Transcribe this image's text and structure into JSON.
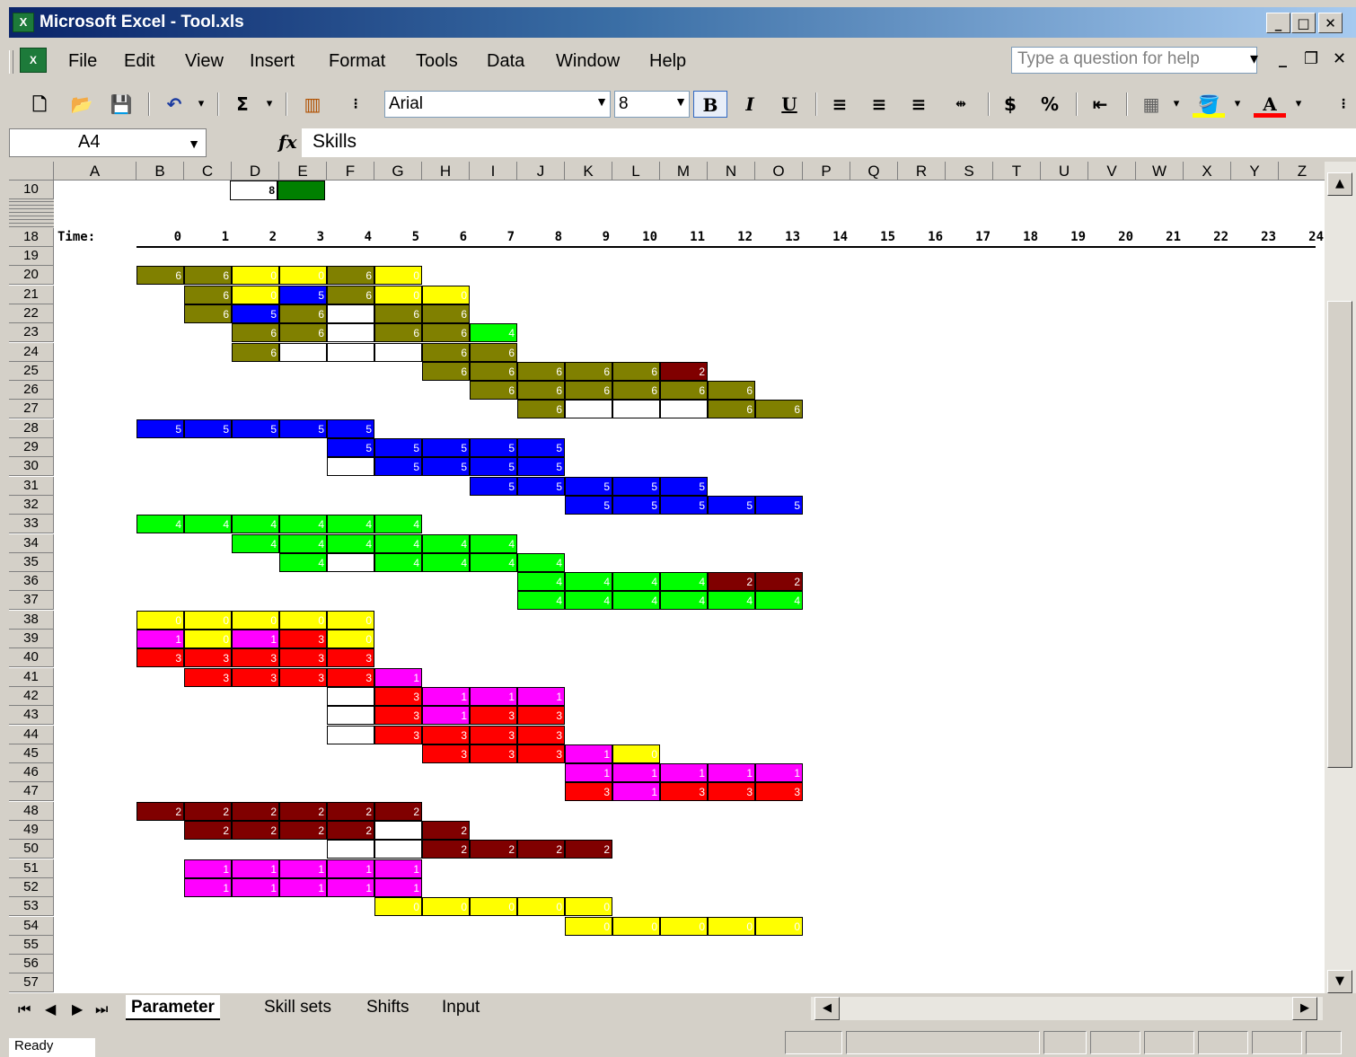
{
  "window": {
    "title": "Microsoft Excel - Tool.xls"
  },
  "menu": {
    "items": [
      "File",
      "Edit",
      "View",
      "Insert",
      "Format",
      "Tools",
      "Data",
      "Window",
      "Help"
    ],
    "help_placeholder": "Type a question for help"
  },
  "toolbar": {
    "font_name": "Arial",
    "font_size": "8",
    "bold": "B",
    "italic": "I",
    "underline": "U",
    "currency": "$",
    "percent": "%",
    "autosum": "Σ"
  },
  "formula_bar": {
    "cell_ref": "A4",
    "fx": "fx",
    "value": "Skills"
  },
  "sheet": {
    "columns": [
      "A",
      "B",
      "C",
      "D",
      "E",
      "F",
      "G",
      "H",
      "I",
      "J",
      "K",
      "L",
      "M",
      "N",
      "O",
      "P",
      "Q",
      "R",
      "S",
      "T",
      "U",
      "V",
      "W",
      "X",
      "Y",
      "Z"
    ],
    "rows": [
      "10",
      "18",
      "19",
      "20",
      "21",
      "22",
      "23",
      "24",
      "25",
      "26",
      "27",
      "28",
      "29",
      "30",
      "31",
      "32",
      "33",
      "34",
      "35",
      "36",
      "37",
      "38",
      "39",
      "40",
      "41",
      "42",
      "43",
      "44",
      "45",
      "46",
      "47",
      "48",
      "49",
      "50",
      "51",
      "52",
      "53",
      "54",
      "55",
      "56",
      "57"
    ],
    "time_label": "Time:",
    "time_values": [
      "0",
      "1",
      "2",
      "3",
      "4",
      "5",
      "6",
      "7",
      "8",
      "9",
      "10",
      "11",
      "12",
      "13",
      "14",
      "15",
      "16",
      "17",
      "18",
      "19",
      "20",
      "21",
      "22",
      "23",
      "24"
    ],
    "row10": {
      "d_value": "8",
      "e_color": "#008000"
    },
    "palette": {
      "o": "#808000",
      "y": "#ffff00",
      "b": "#0000ff",
      "g": "#00ff00",
      "r": "#ff0000",
      "m": "#ff00ff",
      "d": "#800000",
      "w": "#ffffff"
    },
    "grid": [
      [
        "row20",
        "1:o:6",
        "2:o:6",
        "3:y:0",
        "4:y:0",
        "5:o:6",
        "6:y:0"
      ],
      [
        "row21",
        "2:o:6",
        "3:y:0",
        "4:b:5",
        "5:o:6",
        "6:y:0",
        "7:y:0"
      ],
      [
        "row22",
        "2:o:6",
        "3:b:5",
        "4:o:6",
        "5:w:",
        "6:o:6",
        "7:o:6"
      ],
      [
        "row23",
        "3:o:6",
        "4:o:6",
        "5:w:",
        "6:o:6",
        "7:o:6",
        "8:g:4"
      ],
      [
        "row24",
        "3:o:6",
        "4:w:",
        "5:w:",
        "6:w:",
        "7:o:6",
        "8:o:6"
      ],
      [
        "row25",
        "7:o:6",
        "8:o:6",
        "9:o:6",
        "10:o:6",
        "11:o:6",
        "12:d:2"
      ],
      [
        "row26",
        "8:o:6",
        "9:o:6",
        "10:o:6",
        "11:o:6",
        "12:o:6",
        "13:o:6"
      ],
      [
        "row27",
        "9:o:6",
        "10:w:",
        "11:w:",
        "12:w:",
        "13:o:6",
        "14:o:6"
      ],
      [
        "row28",
        "1:b:5",
        "2:b:5",
        "3:b:5",
        "4:b:5",
        "5:b:5"
      ],
      [
        "row29",
        "5:b:5",
        "6:b:5",
        "7:b:5",
        "8:b:5",
        "9:b:5"
      ],
      [
        "row30",
        "5:w:",
        "6:b:5",
        "7:b:5",
        "8:b:5",
        "9:b:5"
      ],
      [
        "row31",
        "8:b:5",
        "9:b:5",
        "10:b:5",
        "11:b:5",
        "12:b:5"
      ],
      [
        "row32",
        "10:b:5",
        "11:b:5",
        "12:b:5",
        "13:b:5",
        "14:b:5"
      ],
      [
        "row33",
        "1:g:4",
        "2:g:4",
        "3:g:4",
        "4:g:4",
        "5:g:4",
        "6:g:4"
      ],
      [
        "row34",
        "3:g:4",
        "4:g:4",
        "5:g:4",
        "6:g:4",
        "7:g:4",
        "8:g:4"
      ],
      [
        "row35",
        "4:g:4",
        "5:w:",
        "6:g:4",
        "7:g:4",
        "8:g:4",
        "9:g:4"
      ],
      [
        "row36",
        "9:g:4",
        "10:g:4",
        "11:g:4",
        "12:g:4",
        "13:d:2",
        "14:d:2"
      ],
      [
        "row37",
        "9:g:4",
        "10:g:4",
        "11:g:4",
        "12:g:4",
        "13:g:4",
        "14:g:4"
      ],
      [
        "row38",
        "1:y:0",
        "2:y:0",
        "3:y:0",
        "4:y:0",
        "5:y:0"
      ],
      [
        "row39",
        "1:m:1",
        "2:y:0",
        "3:m:1",
        "4:r:3",
        "5:y:0"
      ],
      [
        "row40",
        "1:r:3",
        "2:r:3",
        "3:r:3",
        "4:r:3",
        "5:r:3"
      ],
      [
        "row41",
        "2:r:3",
        "3:r:3",
        "4:r:3",
        "5:r:3",
        "6:m:1"
      ],
      [
        "row42",
        "5:w:",
        "6:r:3",
        "7:m:1",
        "8:m:1",
        "9:m:1"
      ],
      [
        "row43",
        "5:w:",
        "6:r:3",
        "7:m:1",
        "8:r:3",
        "9:r:3"
      ],
      [
        "row44",
        "5:w:",
        "6:r:3",
        "7:r:3",
        "8:r:3",
        "9:r:3"
      ],
      [
        "row45",
        "7:r:3",
        "8:r:3",
        "9:r:3",
        "10:m:1",
        "11:y:0"
      ],
      [
        "row46",
        "10:m:1",
        "11:m:1",
        "12:m:1",
        "13:m:1",
        "14:m:1"
      ],
      [
        "row47",
        "10:r:3",
        "11:m:1",
        "12:r:3",
        "13:r:3",
        "14:r:3"
      ],
      [
        "row48",
        "1:d:2",
        "2:d:2",
        "3:d:2",
        "4:d:2",
        "5:d:2",
        "6:d:2"
      ],
      [
        "row49",
        "2:d:2",
        "3:d:2",
        "4:d:2",
        "5:d:2",
        "6:w:",
        "7:d:2"
      ],
      [
        "row50",
        "5:w:",
        "6:w:",
        "7:d:2",
        "8:d:2",
        "9:d:2",
        "10:d:2"
      ],
      [
        "row51",
        "2:m:1",
        "3:m:1",
        "4:m:1",
        "5:m:1",
        "6:m:1"
      ],
      [
        "row52",
        "2:m:1",
        "3:m:1",
        "4:m:1",
        "5:m:1",
        "6:m:1"
      ],
      [
        "row53",
        "6:y:0",
        "7:y:0",
        "8:y:0",
        "9:y:0",
        "10:y:0"
      ],
      [
        "row54",
        "10:y:0",
        "11:y:0",
        "12:y:0",
        "13:y:0",
        "14:y:0"
      ]
    ]
  },
  "tabs": [
    "Parameter",
    "Skill sets",
    "Shifts",
    "Input"
  ],
  "active_tab": "Parameter",
  "status": {
    "text": "Ready"
  }
}
